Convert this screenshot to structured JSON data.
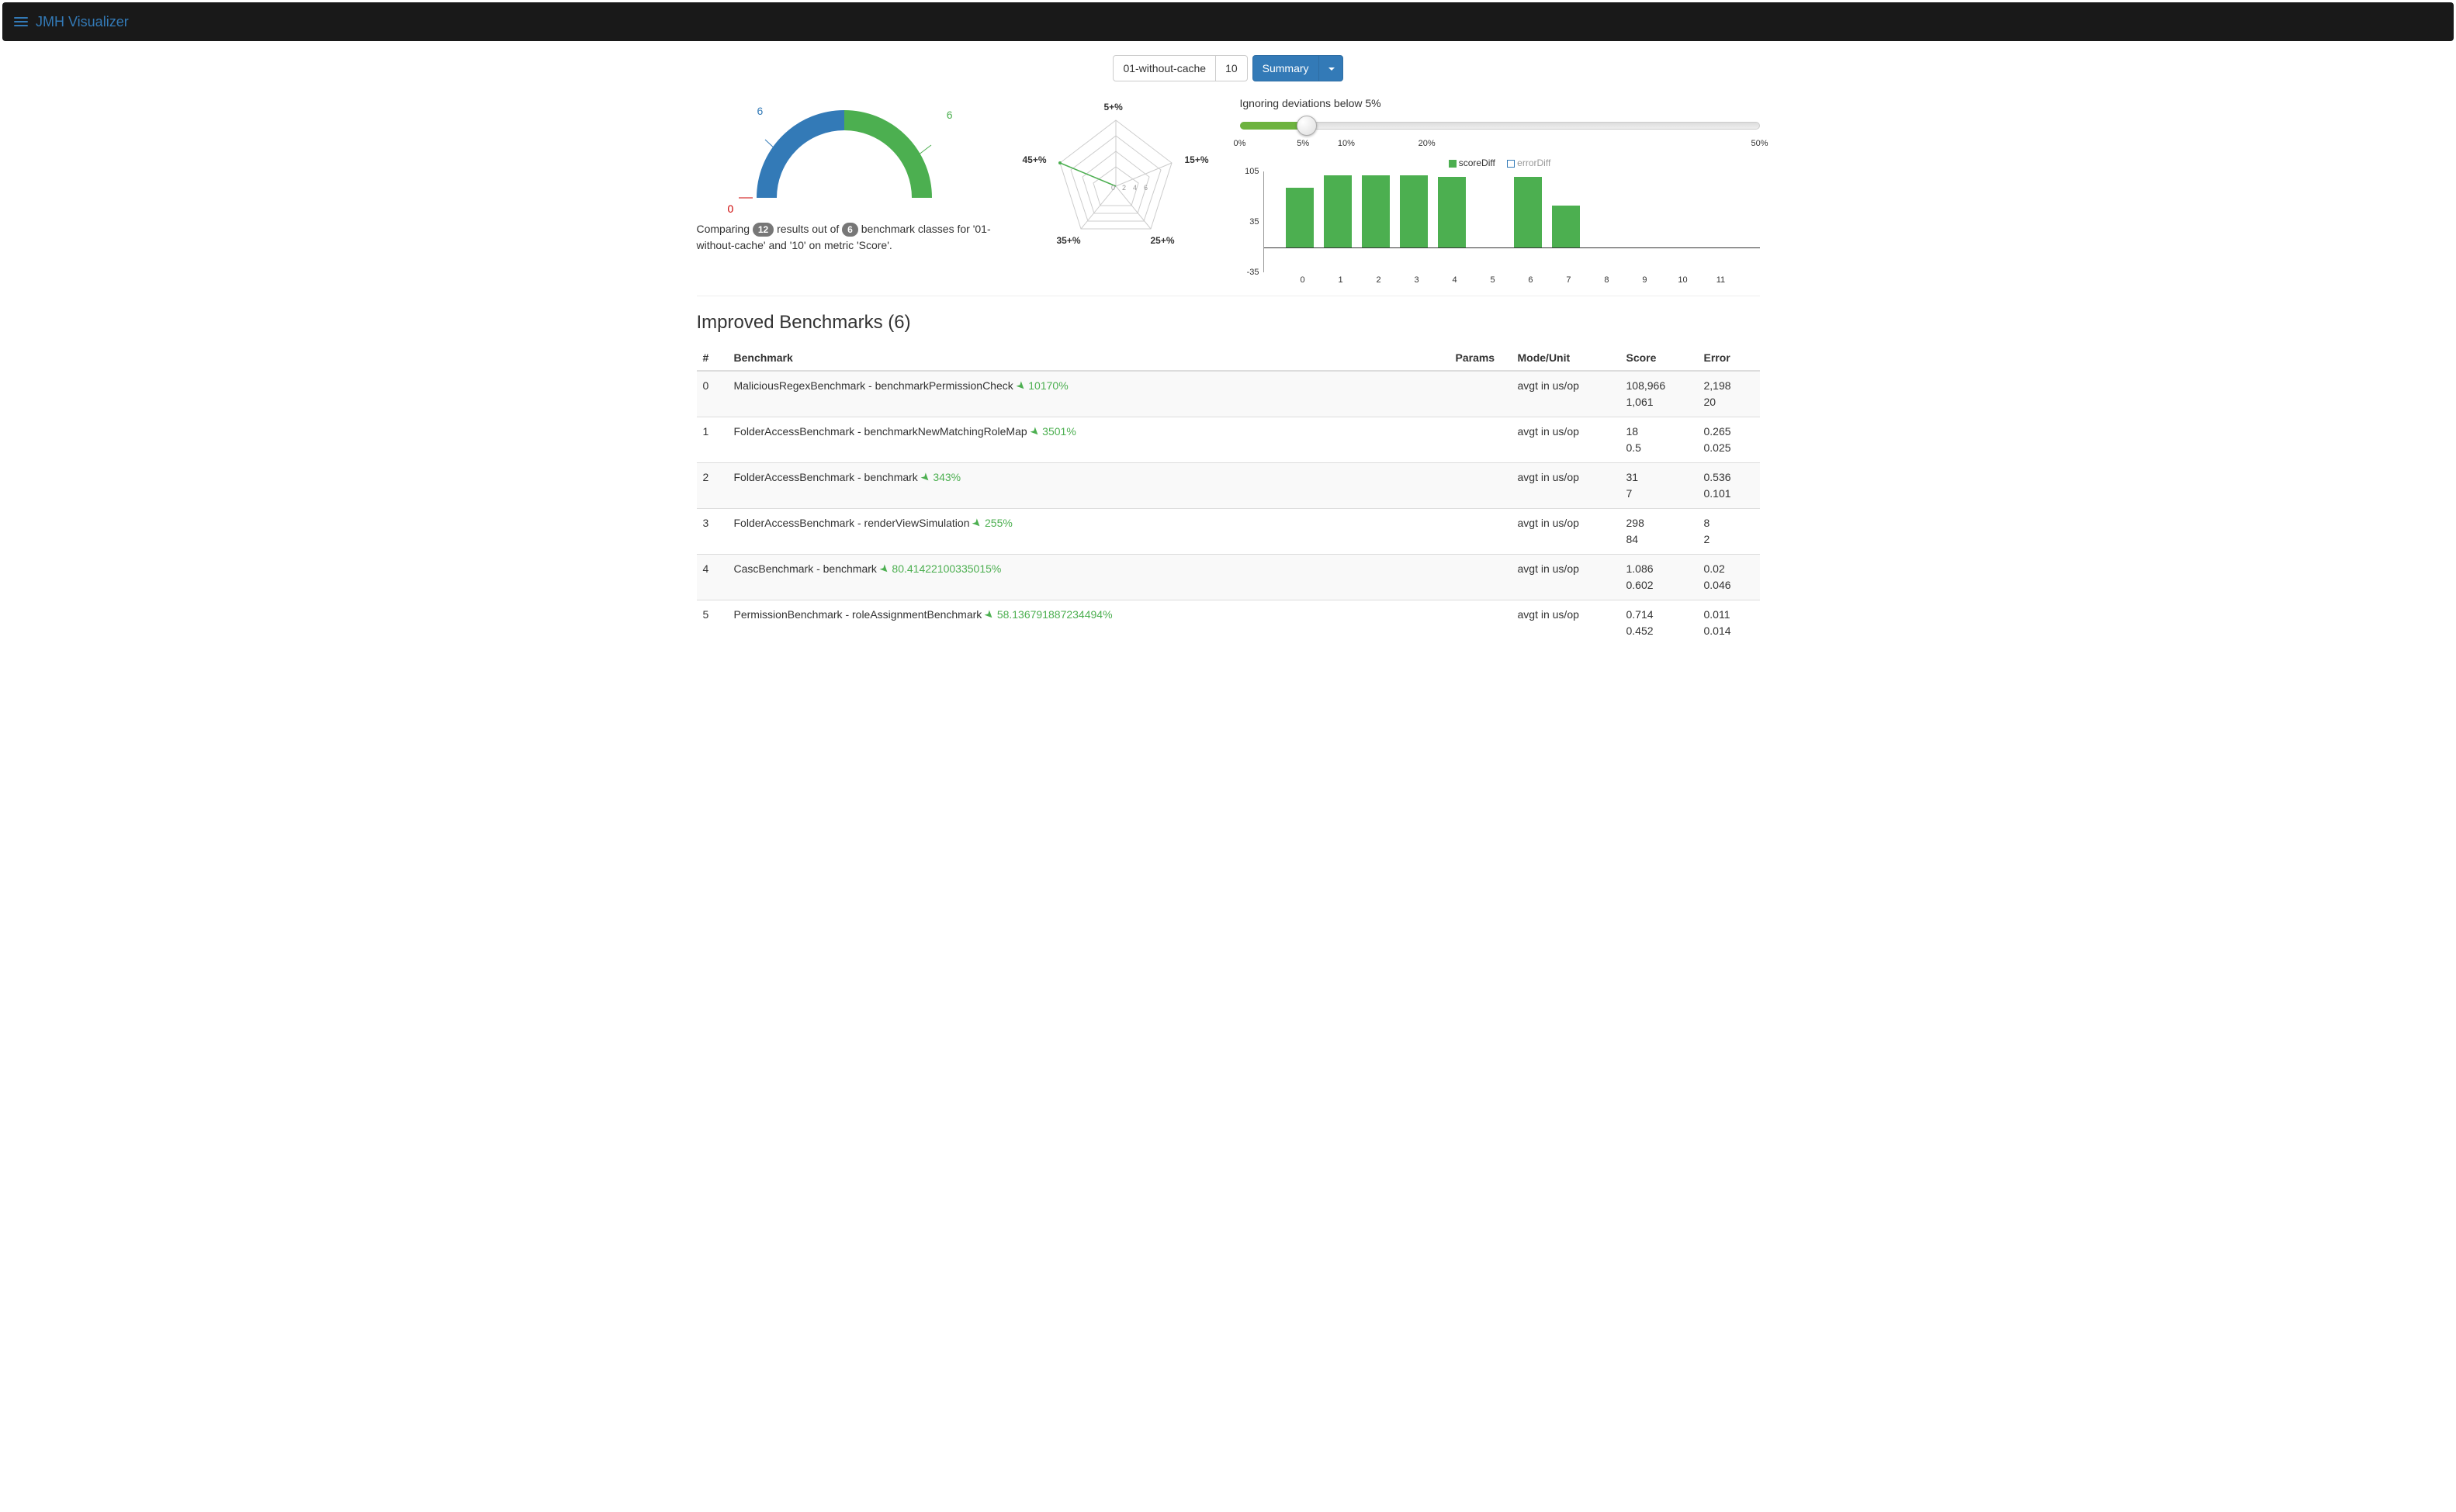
{
  "header": {
    "brand": "JMH Visualizer"
  },
  "toolbar": {
    "run1": "01-without-cache",
    "run2": "10",
    "summary": "Summary"
  },
  "gauge": {
    "zero": "0",
    "left": "6",
    "right": "6"
  },
  "summary": {
    "prefix": "Comparing ",
    "count1": "12",
    "mid1": " results out of ",
    "count2": "6",
    "suffix": " benchmark classes for '01-without-cache' and '10' on metric 'Score'."
  },
  "radar": {
    "labels": [
      "5+%",
      "15+%",
      "25+%",
      "35+%",
      "45+%"
    ],
    "axis_ticks": [
      "0",
      "2",
      "4",
      "6"
    ]
  },
  "slider": {
    "label": "Ignoring deviations below 5%",
    "ticks": [
      {
        "label": "0%",
        "pos": 0
      },
      {
        "label": "5%",
        "pos": 12.2
      },
      {
        "label": "10%",
        "pos": 20.5
      },
      {
        "label": "20%",
        "pos": 36
      },
      {
        "label": "50%",
        "pos": 100
      }
    ]
  },
  "legend": {
    "scoreDiff": "scoreDiff",
    "errorDiff": "errorDiff"
  },
  "chart_data": {
    "type": "bar",
    "title": "",
    "xlabel": "",
    "ylabel": "",
    "ylim": [
      -35,
      105
    ],
    "yticks": [
      -35,
      35,
      105
    ],
    "categories": [
      "0",
      "1",
      "2",
      "3",
      "4",
      "5",
      "6",
      "7",
      "8",
      "9",
      "10",
      "11"
    ],
    "series": [
      {
        "name": "scoreDiff",
        "values": [
          82,
          100,
          100,
          100,
          98,
          0,
          98,
          58,
          0,
          0,
          0,
          0
        ]
      },
      {
        "name": "errorDiff",
        "values": [
          0,
          0,
          0,
          0,
          0,
          0,
          0,
          0,
          0,
          0,
          0,
          0
        ]
      }
    ]
  },
  "section": {
    "title": "Improved Benchmarks (6)"
  },
  "table": {
    "headers": [
      "#",
      "Benchmark",
      "Params",
      "Mode/Unit",
      "Score",
      "Error"
    ],
    "rows": [
      {
        "idx": "0",
        "name": "MaliciousRegexBenchmark - benchmarkPermissionCheck",
        "pct": "10170%",
        "params": "",
        "mode": "avgt in us/op",
        "score1": "108,966",
        "score2": "1,061",
        "err1": "2,198",
        "err2": "20"
      },
      {
        "idx": "1",
        "name": "FolderAccessBenchmark - benchmarkNewMatchingRoleMap",
        "pct": "3501%",
        "params": "",
        "mode": "avgt in us/op",
        "score1": "18",
        "score2": "0.5",
        "err1": "0.265",
        "err2": "0.025"
      },
      {
        "idx": "2",
        "name": "FolderAccessBenchmark - benchmark",
        "pct": "343%",
        "params": "",
        "mode": "avgt in us/op",
        "score1": "31",
        "score2": "7",
        "err1": "0.536",
        "err2": "0.101"
      },
      {
        "idx": "3",
        "name": "FolderAccessBenchmark - renderViewSimulation",
        "pct": "255%",
        "params": "",
        "mode": "avgt in us/op",
        "score1": "298",
        "score2": "84",
        "err1": "8",
        "err2": "2"
      },
      {
        "idx": "4",
        "name": "CascBenchmark - benchmark",
        "pct": "80.41422100335015%",
        "params": "",
        "mode": "avgt in us/op",
        "score1": "1.086",
        "score2": "0.602",
        "err1": "0.02",
        "err2": "0.046"
      },
      {
        "idx": "5",
        "name": "PermissionBenchmark - roleAssignmentBenchmark",
        "pct": "58.136791887234494%",
        "params": "",
        "mode": "avgt in us/op",
        "score1": "0.714",
        "score2": "0.452",
        "err1": "0.011",
        "err2": "0.014"
      }
    ]
  }
}
